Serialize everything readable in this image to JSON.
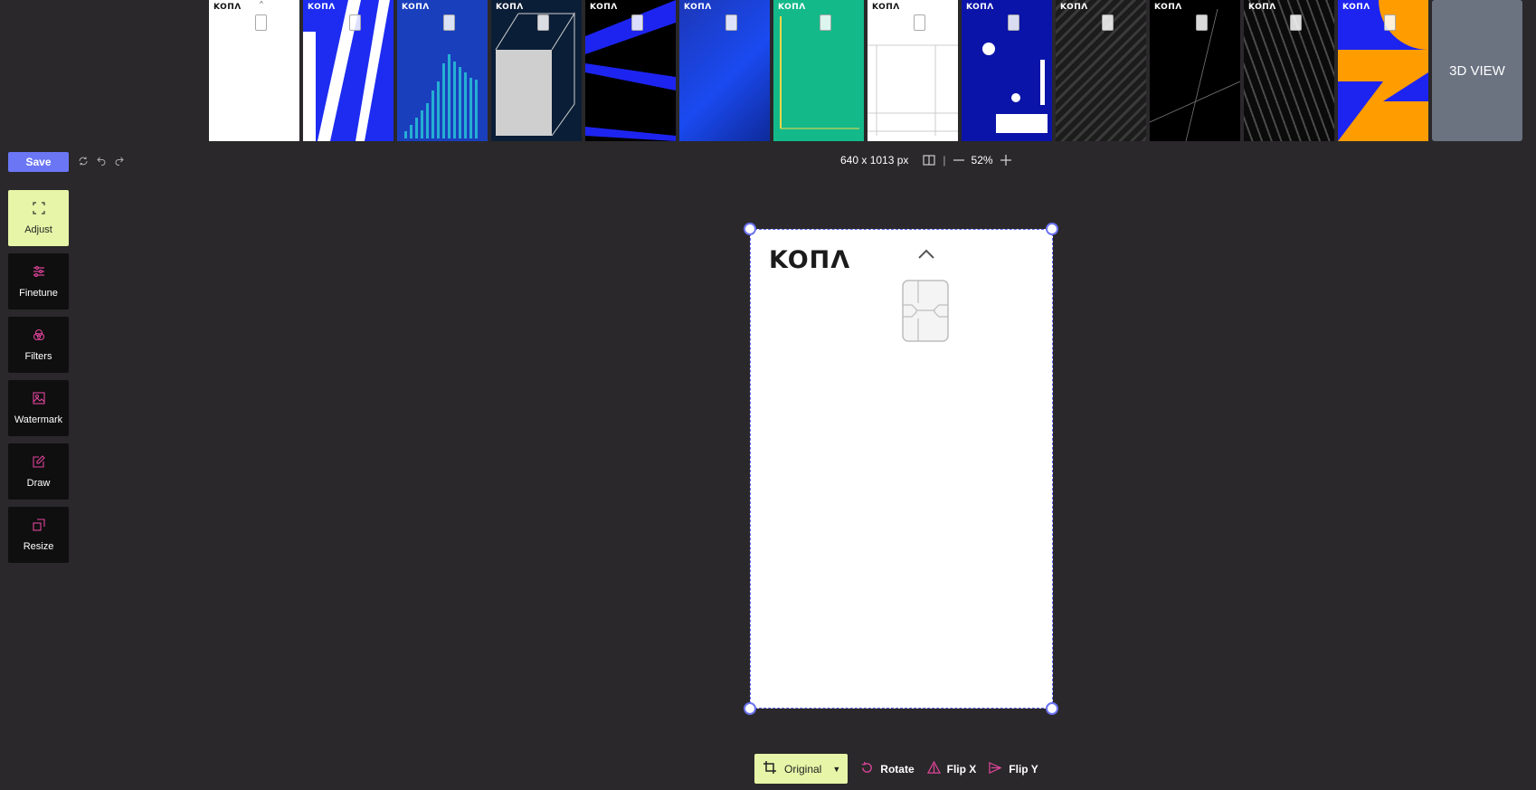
{
  "thumbnails": [
    {
      "logo": "KOПΛ",
      "bg": "#ffffff",
      "fg": "#111111"
    },
    {
      "logo": "KOПΛ",
      "bg": "#1d2cf0",
      "fg": "#ffffff"
    },
    {
      "logo": "KOПΛ",
      "bg": "#1a3fbd",
      "fg": "#ffffff"
    },
    {
      "logo": "KOПΛ",
      "bg": "#0b1e37",
      "fg": "#ffffff"
    },
    {
      "logo": "KOПΛ",
      "bg": "#000000",
      "fg": "#ffffff"
    },
    {
      "logo": "KOПΛ",
      "bg": "#1c37b8",
      "fg": "#ffffff"
    },
    {
      "logo": "KOПΛ",
      "bg": "#14b98a",
      "fg": "#ffffff"
    },
    {
      "logo": "KOПΛ",
      "bg": "#ffffff",
      "fg": "#111111"
    },
    {
      "logo": "KOПΛ",
      "bg": "#0a14a8",
      "fg": "#ffffff"
    },
    {
      "logo": "KOПΛ",
      "bg": "#2b2b2b",
      "fg": "#ffffff"
    },
    {
      "logo": "KOПΛ",
      "bg": "#000000",
      "fg": "#ffffff"
    },
    {
      "logo": "KOПΛ",
      "bg": "#1e1e1e",
      "fg": "#ffffff"
    },
    {
      "logo": "KOПΛ",
      "bg": "#1d24f0",
      "fg": "#ffffff"
    }
  ],
  "view3d_label": "3D VIEW",
  "toolbar": {
    "save_label": "Save",
    "dimensions": "640 x 1013 px",
    "zoom": "52%"
  },
  "tools": [
    {
      "label": "Adjust",
      "icon": "expand-icon",
      "active": true
    },
    {
      "label": "Finetune",
      "icon": "sliders-icon",
      "active": false
    },
    {
      "label": "Filters",
      "icon": "circles-icon",
      "active": false
    },
    {
      "label": "Watermark",
      "icon": "image-icon",
      "active": false
    },
    {
      "label": "Draw",
      "icon": "pencil-icon",
      "active": false
    },
    {
      "label": "Resize",
      "icon": "resize-icon",
      "active": false
    }
  ],
  "canvas": {
    "logo": "KOПΛ",
    "bg": "#ffffff"
  },
  "bottom": {
    "crop_label": "Original",
    "rotate_label": "Rotate",
    "flipx_label": "Flip X",
    "flipy_label": "Flip Y"
  },
  "colors": {
    "accent": "#6b76f5",
    "active_tool": "#e6f5a7",
    "icon_pink": "#e0459b"
  }
}
